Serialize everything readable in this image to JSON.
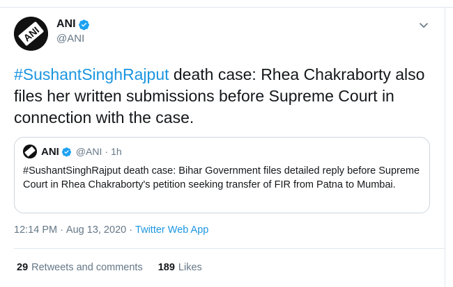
{
  "author": {
    "display_name": "ANI",
    "handle": "@ANI",
    "avatar_text": "ANI",
    "verified": true
  },
  "tweet": {
    "hashtag": "#SushantSinghRajput",
    "body": " death case: Rhea Chakraborty also files her written submissions before Supreme Court in connection with the case."
  },
  "quoted_tweet": {
    "display_name": "ANI",
    "handle": "@ANI",
    "separator": "·",
    "time_ago": "1h",
    "text": "#SushantSinghRajput death case: Bihar Government files detailed reply before Supreme Court in Rhea Chakraborty's petition seeking transfer of FIR from Patna to Mumbai."
  },
  "meta": {
    "time": "12:14 PM",
    "separator": "·",
    "date": "Aug 13, 2020",
    "source": "Twitter Web App"
  },
  "stats": {
    "retweets_count": "29",
    "retweets_label": "Retweets and comments",
    "likes_count": "189",
    "likes_label": "Likes"
  },
  "colors": {
    "link_blue": "#1b95e0",
    "verified_blue": "#1da1f2",
    "secondary_text": "#657786",
    "border": "#e1e8ed"
  },
  "icons": {
    "verified": "verified-badge-icon",
    "caret": "chevron-down-icon"
  }
}
